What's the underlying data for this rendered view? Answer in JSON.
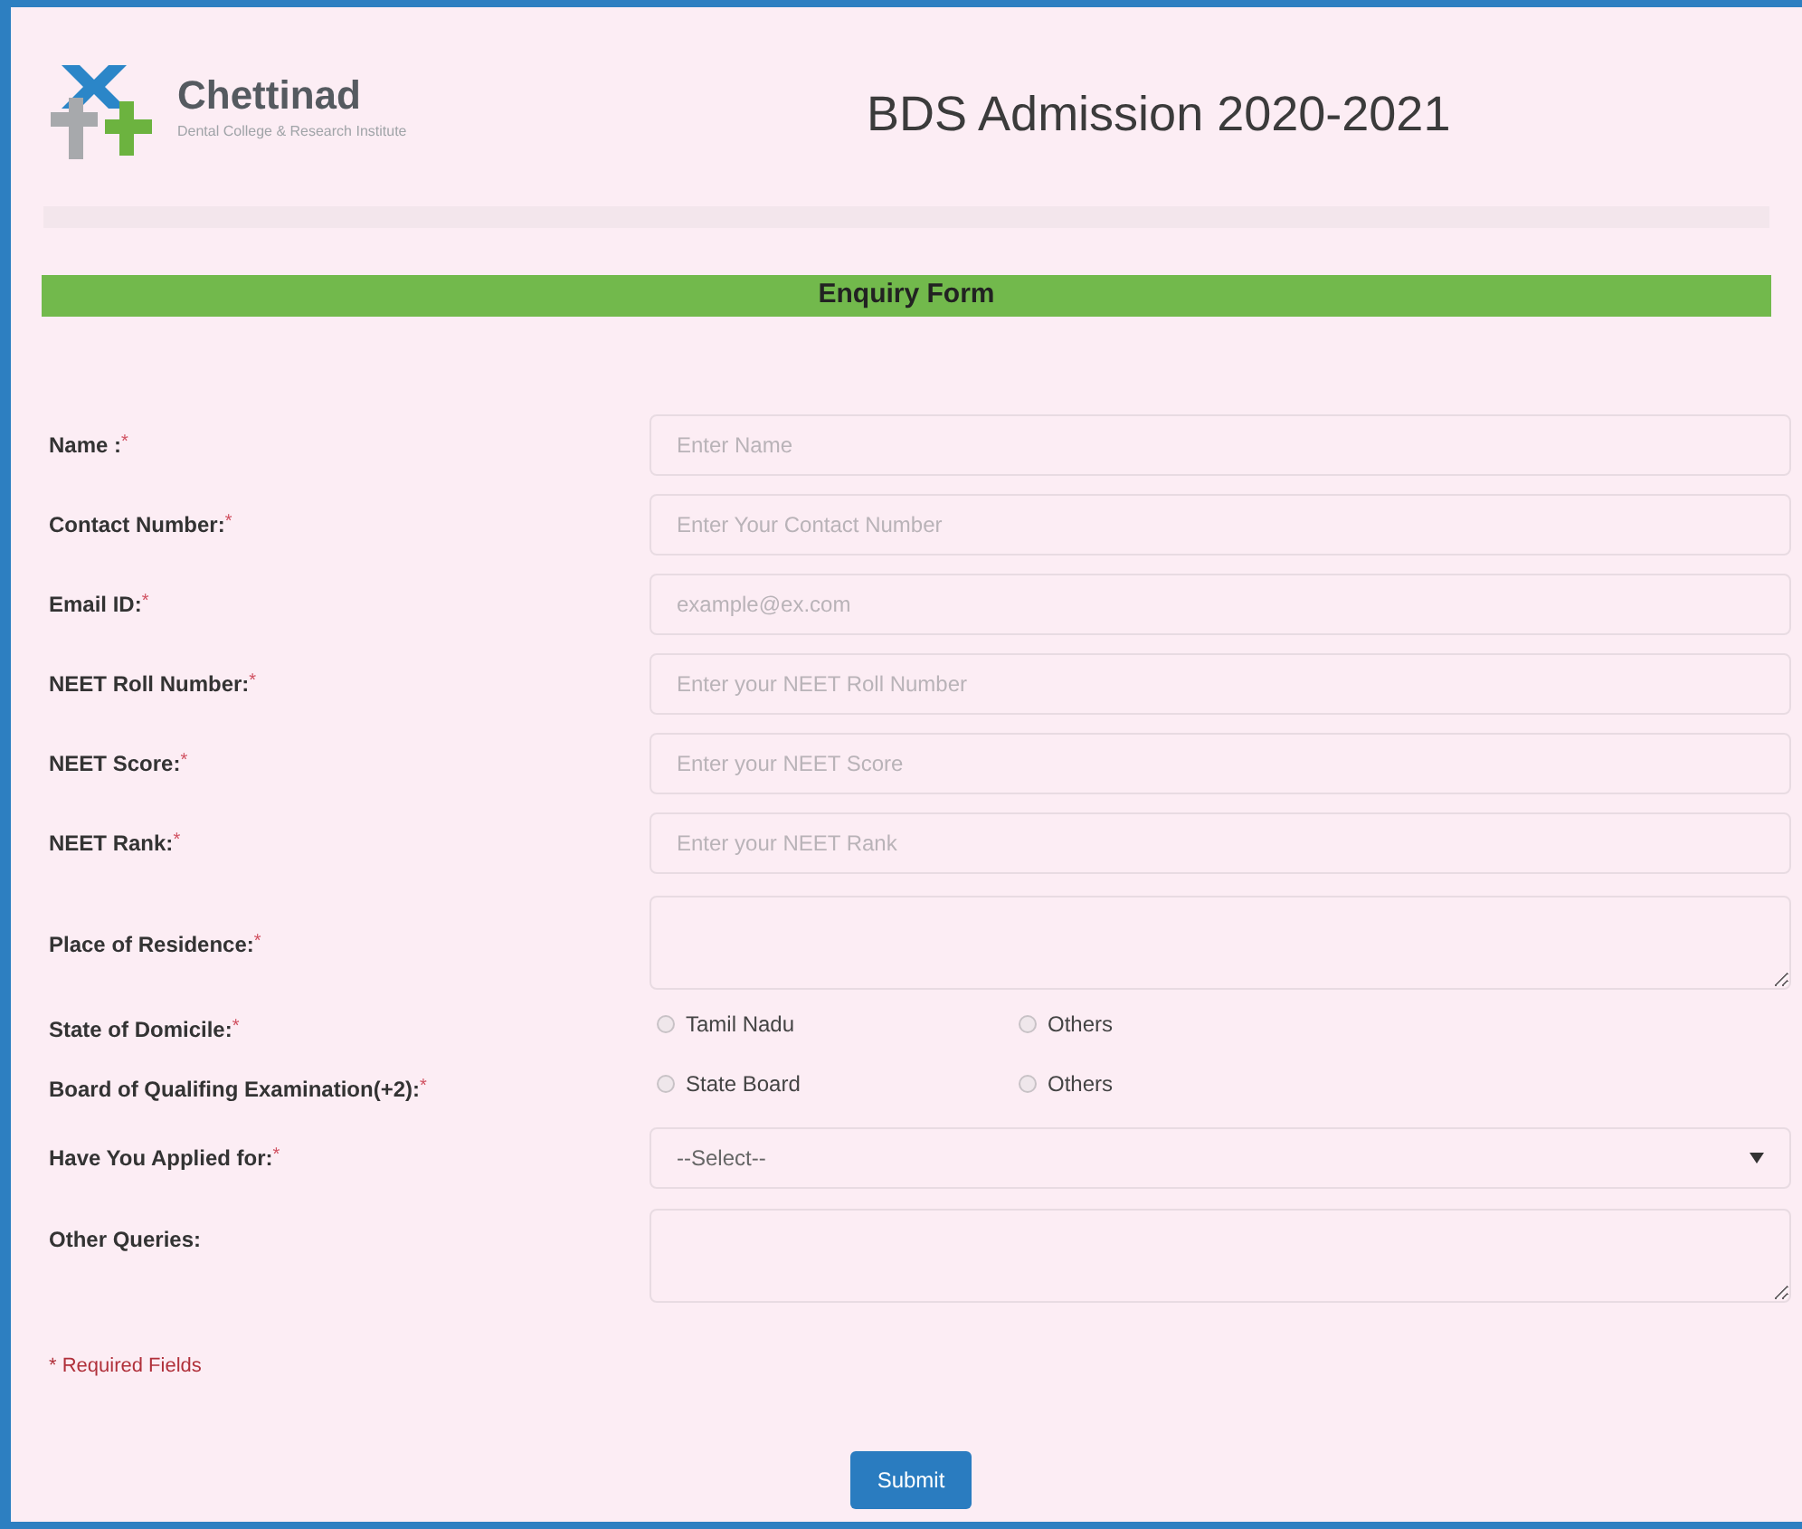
{
  "header": {
    "logo_name": "Chettinad",
    "logo_subtitle": "Dental College & Research Institute",
    "title": "BDS Admission 2020-2021"
  },
  "form": {
    "heading": "Enquiry Form",
    "fields": [
      {
        "kind": "text",
        "label": "Name :",
        "required_mark": "*",
        "placeholder": "Enter Name"
      },
      {
        "kind": "text",
        "label": "Contact Number:",
        "required_mark": "*",
        "placeholder": "Enter Your Contact Number"
      },
      {
        "kind": "text",
        "label": "Email ID:",
        "required_mark": "*",
        "placeholder": "example@ex.com"
      },
      {
        "kind": "text",
        "label": "NEET Roll Number:",
        "required_mark": "*",
        "placeholder": "Enter your NEET Roll Number"
      },
      {
        "kind": "text",
        "label": "NEET Score:",
        "required_mark": "*",
        "placeholder": "Enter your NEET Score"
      },
      {
        "kind": "text",
        "label": "NEET Rank:",
        "required_mark": "*",
        "placeholder": "Enter your NEET Rank"
      },
      {
        "kind": "textarea",
        "label": "Place of Residence:",
        "required_mark": "*"
      },
      {
        "kind": "radio",
        "label": "State of Domicile:",
        "required_mark": "*",
        "options": [
          {
            "label": "Tamil Nadu",
            "selected": false
          },
          {
            "label": "Others",
            "selected": false
          }
        ]
      },
      {
        "kind": "radio",
        "label": "Board of Qualifing Examination(+2):",
        "required_mark": "*",
        "options": [
          {
            "label": "State Board",
            "selected": false
          },
          {
            "label": "Others",
            "selected": false
          }
        ]
      },
      {
        "kind": "select",
        "label": "Have You Applied for:",
        "required_mark": "*",
        "value": "--Select--"
      },
      {
        "kind": "textarea",
        "label": "Other Queries:"
      }
    ],
    "required_note": "* Required Fields",
    "submit": "Submit"
  }
}
